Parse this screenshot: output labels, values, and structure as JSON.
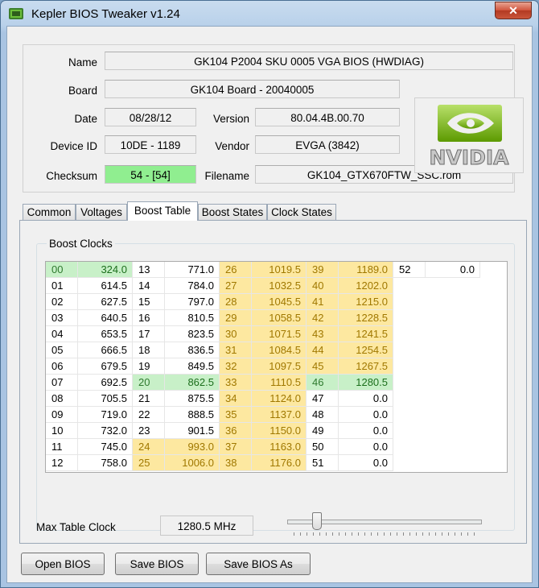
{
  "window": {
    "title": "Kepler BIOS Tweaker v1.24",
    "close_glyph": "✕"
  },
  "info": {
    "name_label": "Name",
    "name_value": "GK104 P2004 SKU 0005 VGA BIOS (HWDIAG)",
    "board_label": "Board",
    "board_value": "GK104 Board - 20040005",
    "date_label": "Date",
    "date_value": "08/28/12",
    "version_label": "Version",
    "version_value": "80.04.4B.00.70",
    "device_label": "Device ID",
    "device_value": "10DE - 1189",
    "vendor_label": "Vendor",
    "vendor_value": "EVGA (3842)",
    "checksum_label": "Checksum",
    "checksum_value": "54 - [54]",
    "filename_label": "Filename",
    "filename_value": "GK104_GTX670FTW_SSC.rom",
    "logo_text": "NVIDIA",
    "logo_color": "#76b900"
  },
  "tabs": [
    {
      "label": "Common",
      "active": false
    },
    {
      "label": "Voltages",
      "active": false
    },
    {
      "label": "Boost Table",
      "active": true
    },
    {
      "label": "Boost States",
      "active": false
    },
    {
      "label": "Clock States",
      "active": false
    }
  ],
  "boost": {
    "group_title": "Boost Clocks",
    "columns": [
      [
        {
          "i": "00",
          "v": "324.0",
          "h": "g"
        },
        {
          "i": "01",
          "v": "614.5"
        },
        {
          "i": "02",
          "v": "627.5"
        },
        {
          "i": "03",
          "v": "640.5"
        },
        {
          "i": "04",
          "v": "653.5"
        },
        {
          "i": "05",
          "v": "666.5"
        },
        {
          "i": "06",
          "v": "679.5"
        },
        {
          "i": "07",
          "v": "692.5"
        },
        {
          "i": "08",
          "v": "705.5"
        },
        {
          "i": "09",
          "v": "719.0"
        },
        {
          "i": "10",
          "v": "732.0"
        },
        {
          "i": "11",
          "v": "745.0"
        },
        {
          "i": "12",
          "v": "758.0"
        }
      ],
      [
        {
          "i": "13",
          "v": "771.0"
        },
        {
          "i": "14",
          "v": "784.0"
        },
        {
          "i": "15",
          "v": "797.0"
        },
        {
          "i": "16",
          "v": "810.5"
        },
        {
          "i": "17",
          "v": "823.5"
        },
        {
          "i": "18",
          "v": "836.5"
        },
        {
          "i": "19",
          "v": "849.5"
        },
        {
          "i": "20",
          "v": "862.5",
          "h": "g"
        },
        {
          "i": "21",
          "v": "875.5"
        },
        {
          "i": "22",
          "v": "888.5"
        },
        {
          "i": "23",
          "v": "901.5"
        },
        {
          "i": "24",
          "v": "993.0",
          "h": "y"
        },
        {
          "i": "25",
          "v": "1006.0",
          "h": "y"
        }
      ],
      [
        {
          "i": "26",
          "v": "1019.5",
          "h": "y"
        },
        {
          "i": "27",
          "v": "1032.5",
          "h": "y"
        },
        {
          "i": "28",
          "v": "1045.5",
          "h": "y"
        },
        {
          "i": "29",
          "v": "1058.5",
          "h": "y"
        },
        {
          "i": "30",
          "v": "1071.5",
          "h": "y"
        },
        {
          "i": "31",
          "v": "1084.5",
          "h": "y"
        },
        {
          "i": "32",
          "v": "1097.5",
          "h": "y"
        },
        {
          "i": "33",
          "v": "1110.5",
          "h": "y"
        },
        {
          "i": "34",
          "v": "1124.0",
          "h": "y"
        },
        {
          "i": "35",
          "v": "1137.0",
          "h": "y"
        },
        {
          "i": "36",
          "v": "1150.0",
          "h": "y"
        },
        {
          "i": "37",
          "v": "1163.0",
          "h": "y"
        },
        {
          "i": "38",
          "v": "1176.0",
          "h": "y"
        }
      ],
      [
        {
          "i": "39",
          "v": "1189.0",
          "h": "y"
        },
        {
          "i": "40",
          "v": "1202.0",
          "h": "y"
        },
        {
          "i": "41",
          "v": "1215.0",
          "h": "y"
        },
        {
          "i": "42",
          "v": "1228.5",
          "h": "y"
        },
        {
          "i": "43",
          "v": "1241.5",
          "h": "y"
        },
        {
          "i": "44",
          "v": "1254.5",
          "h": "y"
        },
        {
          "i": "45",
          "v": "1267.5",
          "h": "y"
        },
        {
          "i": "46",
          "v": "1280.5",
          "h": "g"
        },
        {
          "i": "47",
          "v": "0.0"
        },
        {
          "i": "48",
          "v": "0.0"
        },
        {
          "i": "49",
          "v": "0.0"
        },
        {
          "i": "50",
          "v": "0.0"
        },
        {
          "i": "51",
          "v": "0.0"
        }
      ],
      [
        {
          "i": "52",
          "v": "0.0"
        }
      ]
    ],
    "max_label": "Max Table Clock",
    "max_value": "1280.5 MHz",
    "slider_fraction": 0.15
  },
  "buttons": {
    "open": "Open BIOS",
    "save": "Save BIOS",
    "save_as": "Save BIOS As"
  }
}
